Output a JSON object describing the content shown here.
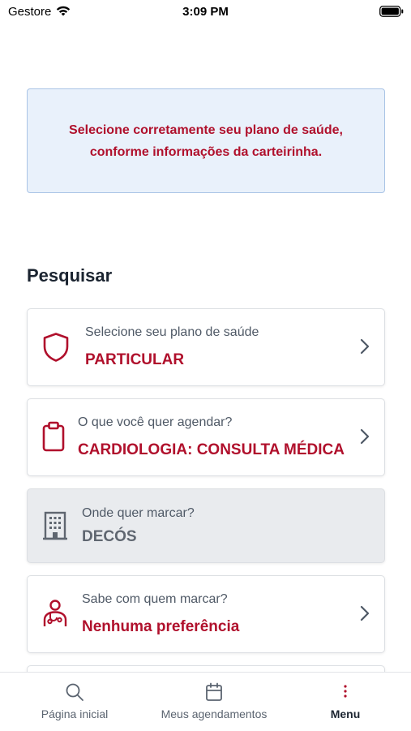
{
  "status_bar": {
    "carrier": "Gestore",
    "time": "3:09 PM"
  },
  "notice": {
    "text": "Selecione corretamente seu plano de saúde, conforme informações da carteirinha."
  },
  "section_title": "Pesquisar",
  "cards": [
    {
      "label": "Selecione seu plano de saúde",
      "value": "PARTICULAR",
      "icon": "shield-icon",
      "enabled": true
    },
    {
      "label": "O que você quer agendar?",
      "value": "CARDIOLOGIA: CONSULTA MÉDICA",
      "icon": "clipboard-icon",
      "enabled": true
    },
    {
      "label": "Onde quer marcar?",
      "value": "DECÓS",
      "icon": "building-icon",
      "enabled": false
    },
    {
      "label": "Sabe com quem marcar?",
      "value": "Nenhuma preferência",
      "icon": "doctor-icon",
      "enabled": true
    }
  ],
  "bottom_nav": [
    {
      "label": "Página inicial",
      "icon": "search-icon",
      "active": false
    },
    {
      "label": "Meus agendamentos",
      "icon": "calendar-icon",
      "active": false
    },
    {
      "label": "Menu",
      "icon": "more-vertical-icon",
      "active": true
    }
  ],
  "colors": {
    "accent": "#b0102c",
    "notice_bg": "#e9f1fb",
    "notice_border": "#a9c4e6",
    "text": "#1b2430",
    "muted": "#4f5966"
  }
}
